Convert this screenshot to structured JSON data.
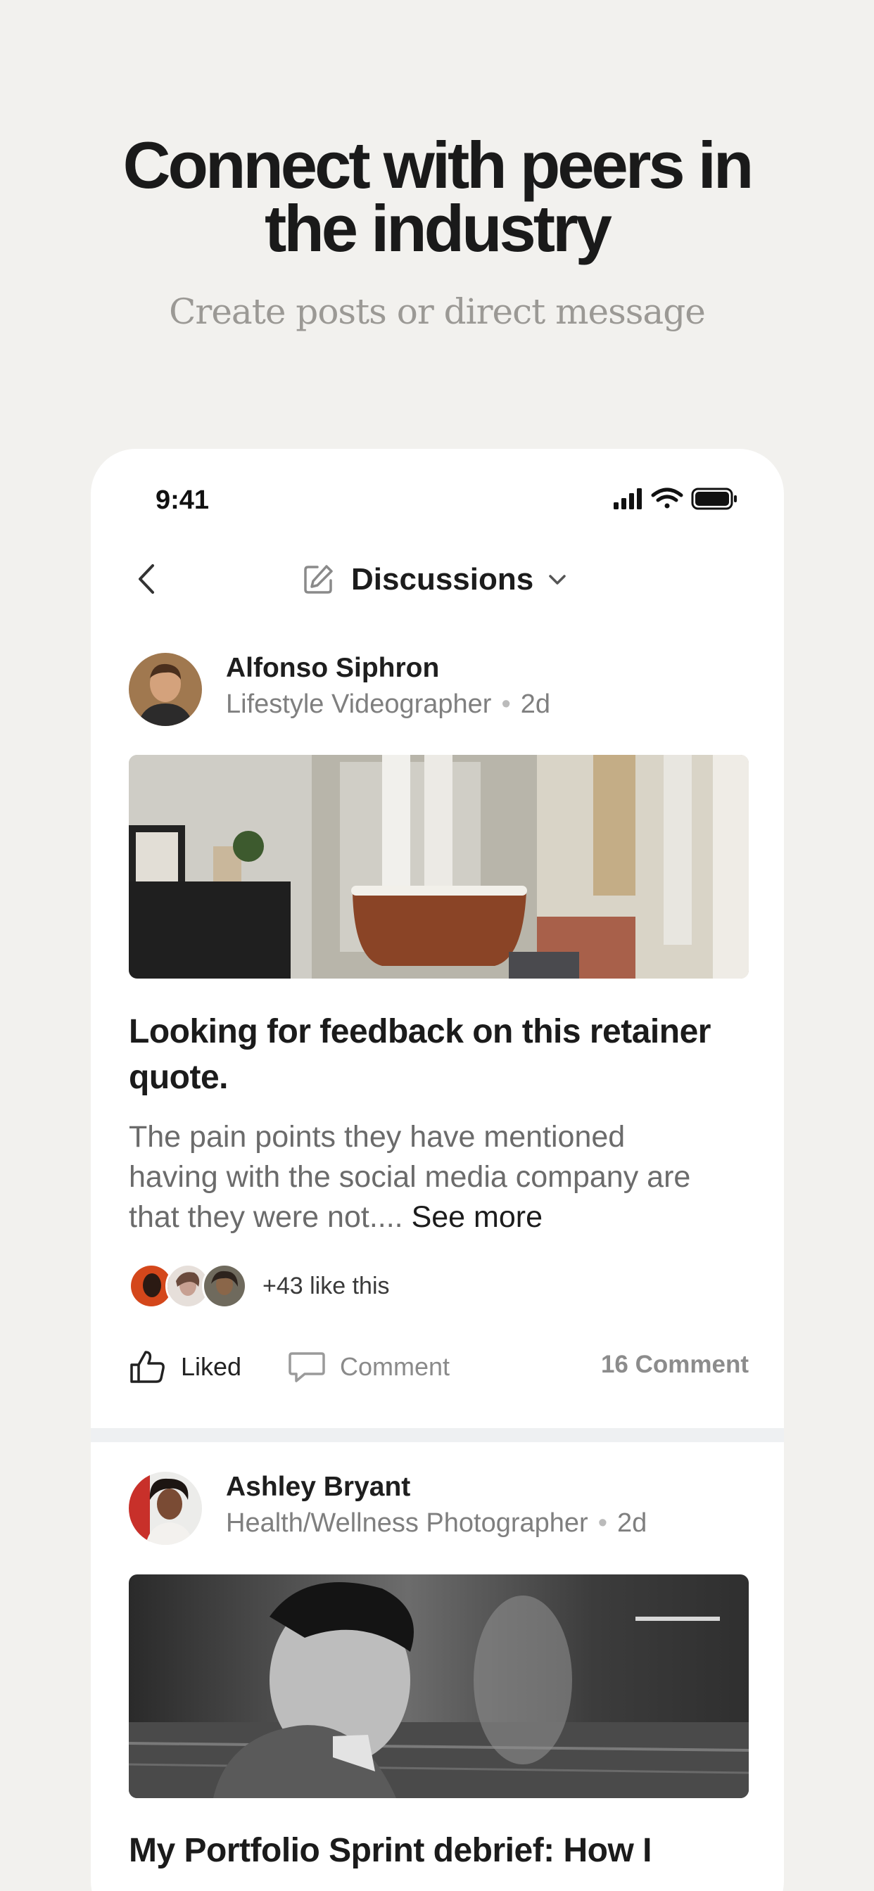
{
  "marketing": {
    "headline_line1": "Connect with peers in",
    "headline_line2": "the industry",
    "subheadline": "Create posts or direct message"
  },
  "status_bar": {
    "time": "9:41",
    "icons": [
      "signal-icon",
      "wifi-icon",
      "battery-icon"
    ]
  },
  "nav": {
    "title": "Discussions",
    "icons": [
      "back-icon",
      "edit-icon",
      "chevron-down-icon"
    ]
  },
  "posts": [
    {
      "author": "Alfonso Siphron",
      "role": "Lifestyle Videographer",
      "age": "2d",
      "title_line1": "Looking for feedback on this retainer",
      "title_line2": "quote.",
      "body_line1": "The pain points they have mentioned",
      "body_line2": "having with the social media company are",
      "body_line3": "that they were not....",
      "see_more": "See more",
      "likes_text": "+43 like this",
      "like_label": "Liked",
      "comment_label": "Comment",
      "comment_count": "16 Comment"
    },
    {
      "author": "Ashley Bryant",
      "role": "Health/Wellness Photographer",
      "age": "2d",
      "title_line1": "My Portfolio Sprint debrief: How I"
    }
  ],
  "colors": {
    "background": "#f2f1ee",
    "card": "#ffffff",
    "text_primary": "#1c1c1c",
    "text_secondary": "#7f7f7f",
    "divider": "#eef0f2"
  }
}
